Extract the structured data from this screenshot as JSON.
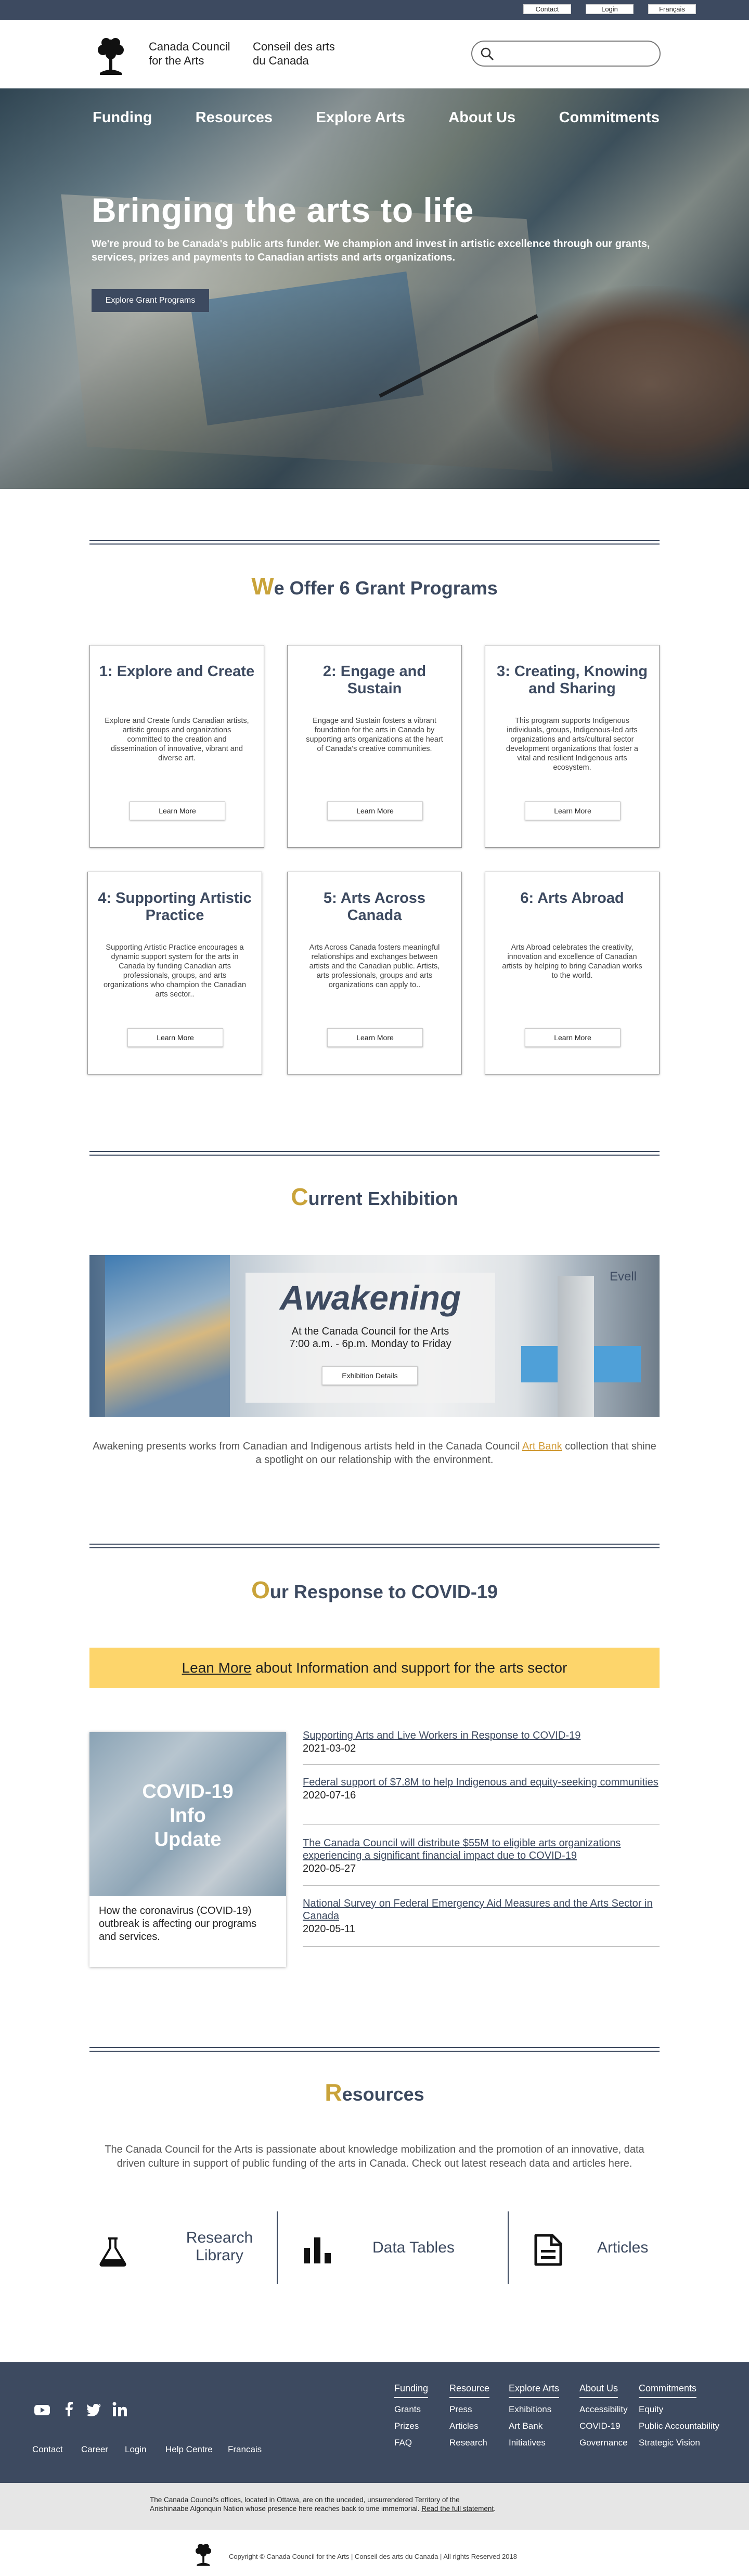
{
  "utility": {
    "contact": "Contact",
    "login": "Login",
    "francais": "Français"
  },
  "brand": {
    "en_line1": "Canada Council",
    "en_line2": "for the Arts",
    "fr_line1": "Conseil des arts",
    "fr_line2": "du Canada"
  },
  "nav": [
    "Funding",
    "Resources",
    "Explore Arts",
    "About Us",
    "Commitments"
  ],
  "hero": {
    "title": "Bringing the arts to life",
    "subtitle": "We're proud to be Canada's public arts funder. We champion and invest in artistic excellence through our grants, services, prizes and payments to Canadian artists and arts organizations.",
    "cta": "Explore Grant Programs"
  },
  "grants": {
    "title_cap": "W",
    "title_rest": "e Offer 6 Grant Programs",
    "learn_more": "Learn More",
    "cards": [
      {
        "title": "1: Explore and Create",
        "text": "Explore and Create funds Canadian artists, artistic groups and organizations committed to the creation and dissemination of innovative, vibrant and diverse art."
      },
      {
        "title": "2: Engage and Sustain",
        "text": "Engage and Sustain fosters a vibrant foundation for the arts in Canada by supporting arts organizations at the heart of Canada's creative communities."
      },
      {
        "title": "3: Creating, Knowing and Sharing",
        "text": "This program supports Indigenous individuals, groups, Indigenous-led arts organizations and arts/cultural sector development organizations that foster a vital and resilient Indigenous arts ecosystem."
      },
      {
        "title": "4: Supporting Artistic Practice",
        "text": "Supporting Artistic Practice encourages a dynamic support system for the arts in Canada by funding Canadian arts professionals, groups, and arts organizations who champion the Canadian arts sector.."
      },
      {
        "title": "5: Arts Across Canada",
        "text": "Arts Across Canada fosters meaningful relationships and exchanges between artists and the Canadian public. Artists, arts professionals, groups and arts organizations can apply to.."
      },
      {
        "title": "6: Arts Abroad",
        "text": "Arts Abroad celebrates the creativity, innovation and excellence of Canadian artists by helping to bring Canadian works to the world."
      }
    ]
  },
  "exhibition": {
    "title_cap": "C",
    "title_rest": "urrent Exhibition",
    "name": "Awakening",
    "line1": "At the Canada Council for the Arts",
    "line2": "7:00 a.m. - 6p.m. Monday to Friday",
    "button": "Exhibition Details",
    "desc_a": "Awakening presents works from Canadian and Indigenous artists held in the Canada Council ",
    "desc_link": "Art Bank",
    "desc_b": " collection that shine a spotlight on our relationship with the environment.",
    "wall_text": "Evell"
  },
  "covid": {
    "title_cap": "O",
    "title_rest": "ur Response to COVID-19",
    "band_link": "Lean More",
    "band_text": " about Information and support for the arts sector",
    "card_img": "COVID-19 Info Update",
    "card_caption": "How the coronavirus (COVID-19) outbreak is affecting our programs and services.",
    "news": [
      {
        "title": "Supporting Arts and Live Workers in Response to COVID-19",
        "date": "2021-03-02"
      },
      {
        "title": "Federal support of $7.8M to help Indigenous and equity-seeking communities",
        "date": "2020-07-16"
      },
      {
        "title": "The Canada Council will distribute $55M to eligible arts organizations experiencing a significant financial impact due to COVID-19",
        "date": "2020-05-27"
      },
      {
        "title": "National Survey on Federal Emergency Aid Measures and the Arts Sector in Canada",
        "date": "2020-05-11"
      }
    ]
  },
  "resources": {
    "title_cap": "R",
    "title_rest": "esources",
    "text": "The Canada Council for the Arts is passionate about knowledge mobilization and the promotion of an innovative, data driven culture in support of public funding of the arts in Canada. Check out latest reseach data and articles here.",
    "items": [
      "Research Library",
      "Data Tables",
      "Articles"
    ]
  },
  "footer": {
    "links": [
      "Contact",
      "Career",
      "Login",
      "Help Centre",
      "Francais"
    ],
    "cols": [
      {
        "head": "Funding",
        "items": [
          "Grants",
          "Prizes",
          "FAQ"
        ]
      },
      {
        "head": "Resource",
        "items": [
          "Press",
          "Articles",
          "Research"
        ]
      },
      {
        "head": "Explore Arts",
        "items": [
          "Exhibitions",
          "Art Bank",
          "Initiatives"
        ]
      },
      {
        "head": "About Us",
        "items": [
          "Accessibility",
          "COVID-19",
          "Governance"
        ]
      },
      {
        "head": "Commitments",
        "items": [
          "Equity",
          "Public Accountability",
          "Strategic Vision"
        ]
      }
    ],
    "land_1": "The Canada Council's offices, located in Ottawa, are on the unceded, unsurrendered Territory of the",
    "land_2": "Anishinaabe Algonquin Nation whose presence here reaches back to time immemorial. ",
    "land_link": "Read the full statement",
    "land_end": ".",
    "copyright": "Copyright © Canada Council for the Arts | Conseil des arts du Canada | All rights Reserved 2018"
  },
  "colors": {
    "navy": "#3d4a60",
    "gold": "#c9a33a",
    "band": "#fdd56b",
    "link_orange": "#d19a35"
  },
  "icons": [
    "search-icon",
    "tree-logo",
    "youtube-icon",
    "facebook-icon",
    "twitter-icon",
    "linkedin-icon",
    "flask-icon",
    "bar-chart-icon",
    "document-icon"
  ]
}
